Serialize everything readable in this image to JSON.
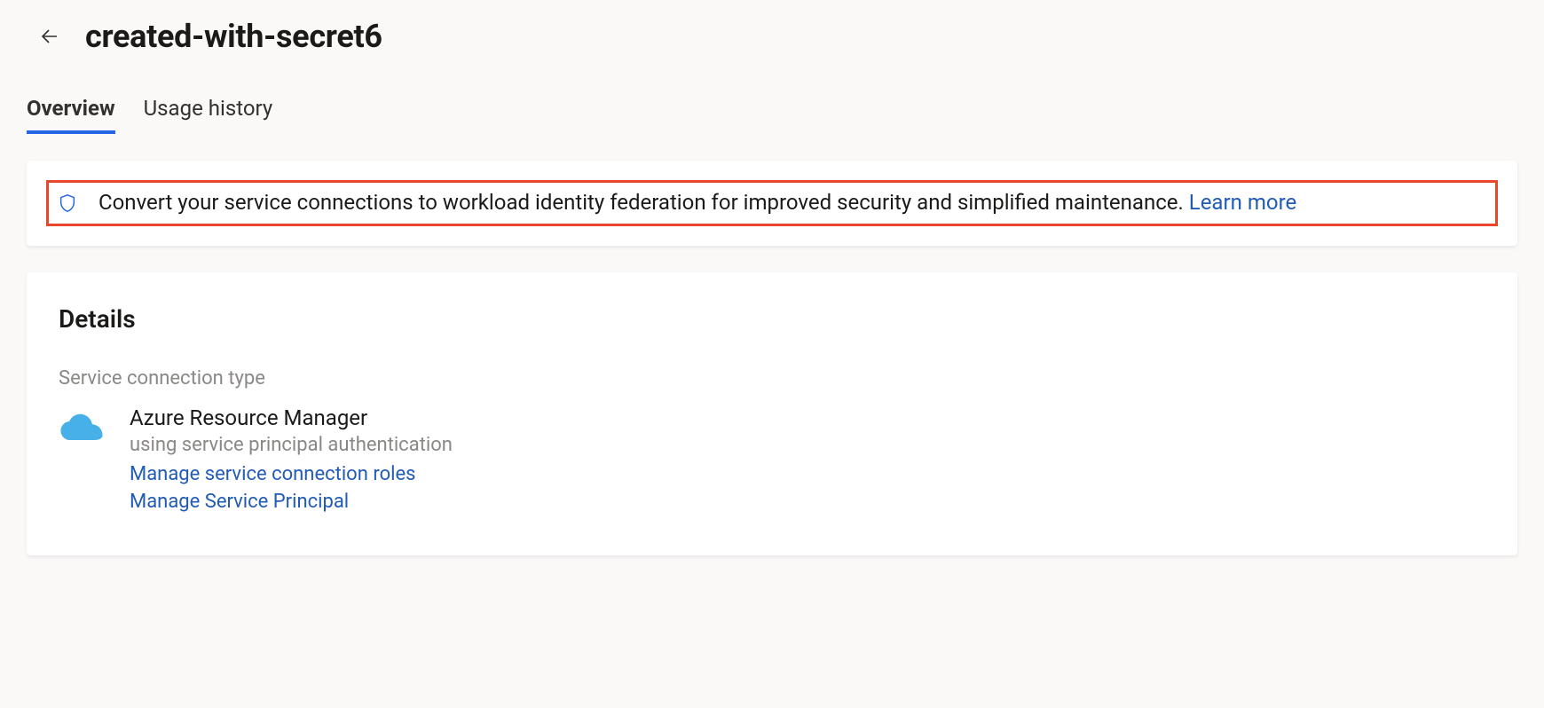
{
  "header": {
    "title": "created-with-secret6"
  },
  "tabs": [
    {
      "label": "Overview",
      "active": true
    },
    {
      "label": "Usage history",
      "active": false
    }
  ],
  "banner": {
    "text": "Convert your service connections to workload identity federation for improved security and simplified maintenance.",
    "link_label": "Learn more"
  },
  "details": {
    "heading": "Details",
    "field_label": "Service connection type",
    "connection": {
      "name": "Azure Resource Manager",
      "subtitle": "using service principal authentication",
      "links": {
        "roles": "Manage service connection roles",
        "principal": "Manage Service Principal"
      }
    }
  }
}
